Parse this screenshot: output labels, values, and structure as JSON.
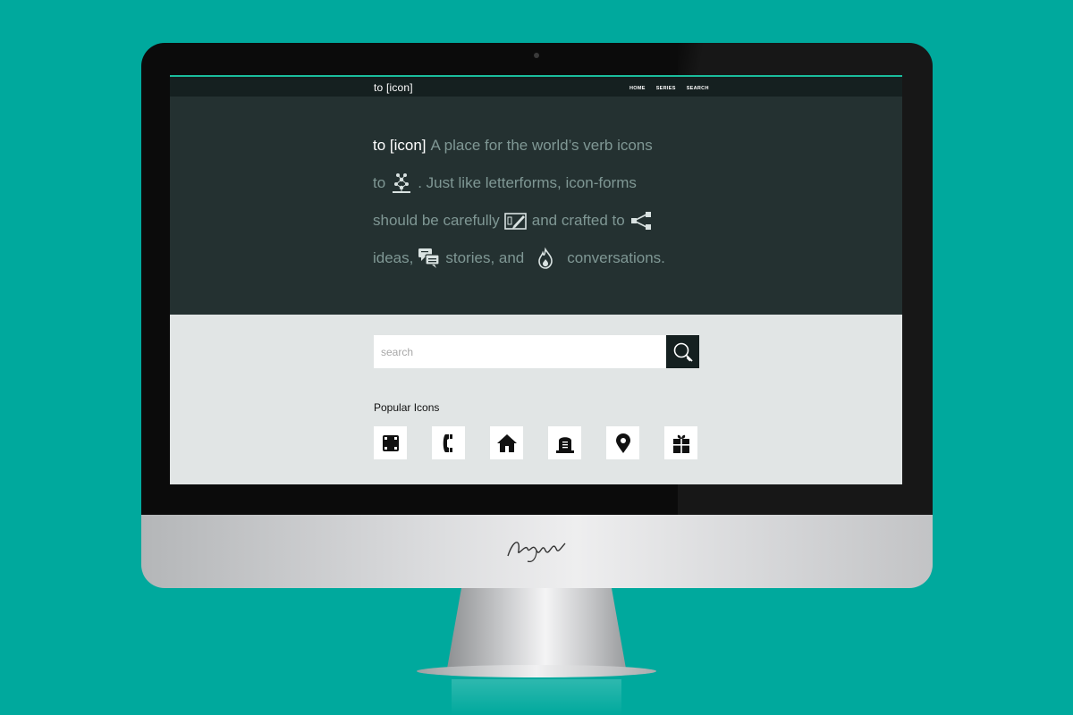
{
  "site": {
    "brand": "to [icon]",
    "nav": [
      "HOME",
      "SERIES",
      "SEARCH"
    ]
  },
  "hero": {
    "line1_strong": "to [icon]",
    "line1_rest": "A place for the world’s verb icons",
    "line2_a": "to",
    "line2_b": ". Just like letterforms, icon-forms",
    "line3_a": "should be carefully",
    "line3_b": "and crafted to",
    "line4_a": "ideas,",
    "line4_b": "stories, and",
    "line4_c": "conversations."
  },
  "search": {
    "placeholder": "search"
  },
  "popular": {
    "title": "Popular Icons",
    "icons": [
      "frame-icon",
      "phone-icon",
      "home-icon",
      "tombstone-icon",
      "location-pin-icon",
      "gift-icon"
    ]
  },
  "colors": {
    "background": "#00a99d",
    "hero": "#243131",
    "navbar": "#152020",
    "accent": "#1abc9c",
    "muted_text": "#7f9794",
    "lower": "#e1e5e5"
  }
}
